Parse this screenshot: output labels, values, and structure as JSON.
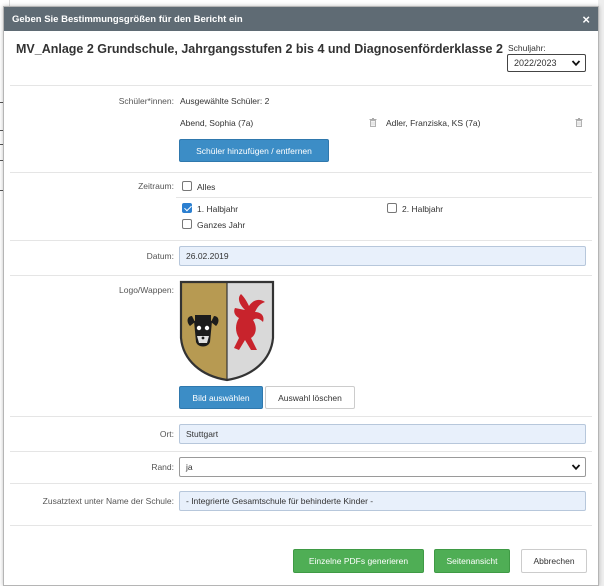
{
  "dialog": {
    "title": "Geben Sie Bestimmungsgrößen für den Bericht ein",
    "close_glyph": "×"
  },
  "header": {
    "title": "MV_Anlage 2 Grundschule, Jahrgangsstufen 2 bis 4 und Diagnosenförderklasse 2",
    "year_label": "Schuljahr:",
    "year_value": "2022/2023"
  },
  "students": {
    "label": "Schüler*innen:",
    "selected_text": "Ausgewählte Schüler: 2",
    "items": [
      "Abend, Sophia (7a)",
      "Adler, Franziska, KS (7a)"
    ],
    "button_label": "Schüler hinzufügen / entfernen"
  },
  "period": {
    "label": "Zeitraum:",
    "options": [
      {
        "label": "Alles",
        "checked": false
      },
      {
        "label": "1. Halbjahr",
        "checked": true
      },
      {
        "label": "2. Halbjahr",
        "checked": false
      },
      {
        "label": "Ganzes Jahr",
        "checked": false
      }
    ]
  },
  "date": {
    "label": "Datum:",
    "value": "26.02.2019"
  },
  "logo": {
    "label": "Logo/Wappen:",
    "select_button": "Bild auswählen",
    "clear_button": "Auswahl löschen"
  },
  "place": {
    "label": "Ort:",
    "value": "Stuttgart"
  },
  "margin": {
    "label": "Rand:",
    "value": "ja"
  },
  "extra": {
    "label": "Zusatztext unter Name der Schule:",
    "value": "- Integrierte Gesamtschule für behinderte Kinder -"
  },
  "footer": {
    "pdf_button": "Einzelne PDFs generieren",
    "preview_button": "Seitenansicht",
    "cancel_button": "Abbrechen"
  },
  "colors": {
    "header_bg": "#5f6b74",
    "primary_blue": "#3c8dc6",
    "success_green": "#4fae55",
    "input_bg": "#e8f0fb"
  }
}
